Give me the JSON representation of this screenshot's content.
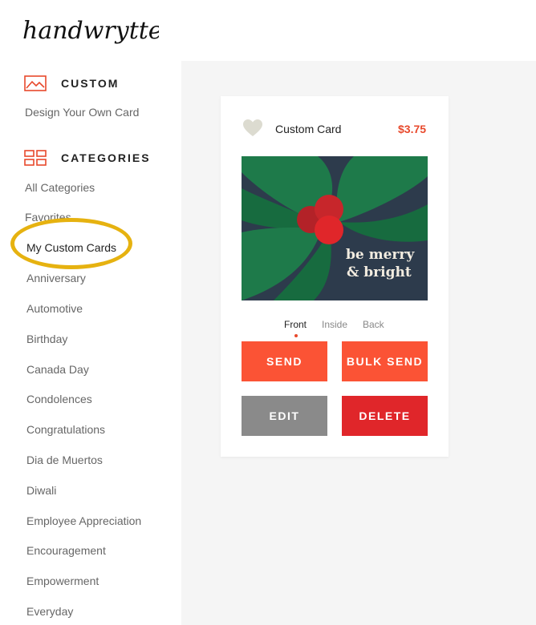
{
  "brand": {
    "logo_text": "handwrytten"
  },
  "sidebar": {
    "custom_title": "CUSTOM",
    "custom_link": "Design Your Own Card",
    "categories_title": "CATEGORIES",
    "categories": [
      "All Categories",
      "Favorites",
      "My Custom Cards",
      "Anniversary",
      "Automotive",
      "Birthday",
      "Canada Day",
      "Condolences",
      "Congratulations",
      "Dia de Muertos",
      "Diwali",
      "Employee Appreciation",
      "Encouragement",
      "Empowerment",
      "Everyday"
    ],
    "active_category": "My Custom Cards"
  },
  "card": {
    "name": "Custom Card",
    "price": "$3.75",
    "image_text_line1": "be merry",
    "image_text_line2": "& bright",
    "tabs": [
      "Front",
      "Inside",
      "Back"
    ],
    "active_tab": "Front"
  },
  "actions": {
    "send": "SEND",
    "bulk_send": "BULK SEND",
    "edit": "EDIT",
    "delete": "DELETE"
  },
  "colors": {
    "accent": "#fb5335",
    "price": "#e8492c",
    "delete": "#e0262a",
    "edit": "#8a8a8a",
    "highlight": "#e6b210",
    "card_bg": "#2d3b4c",
    "leaf_green": "#1e7a4a"
  }
}
